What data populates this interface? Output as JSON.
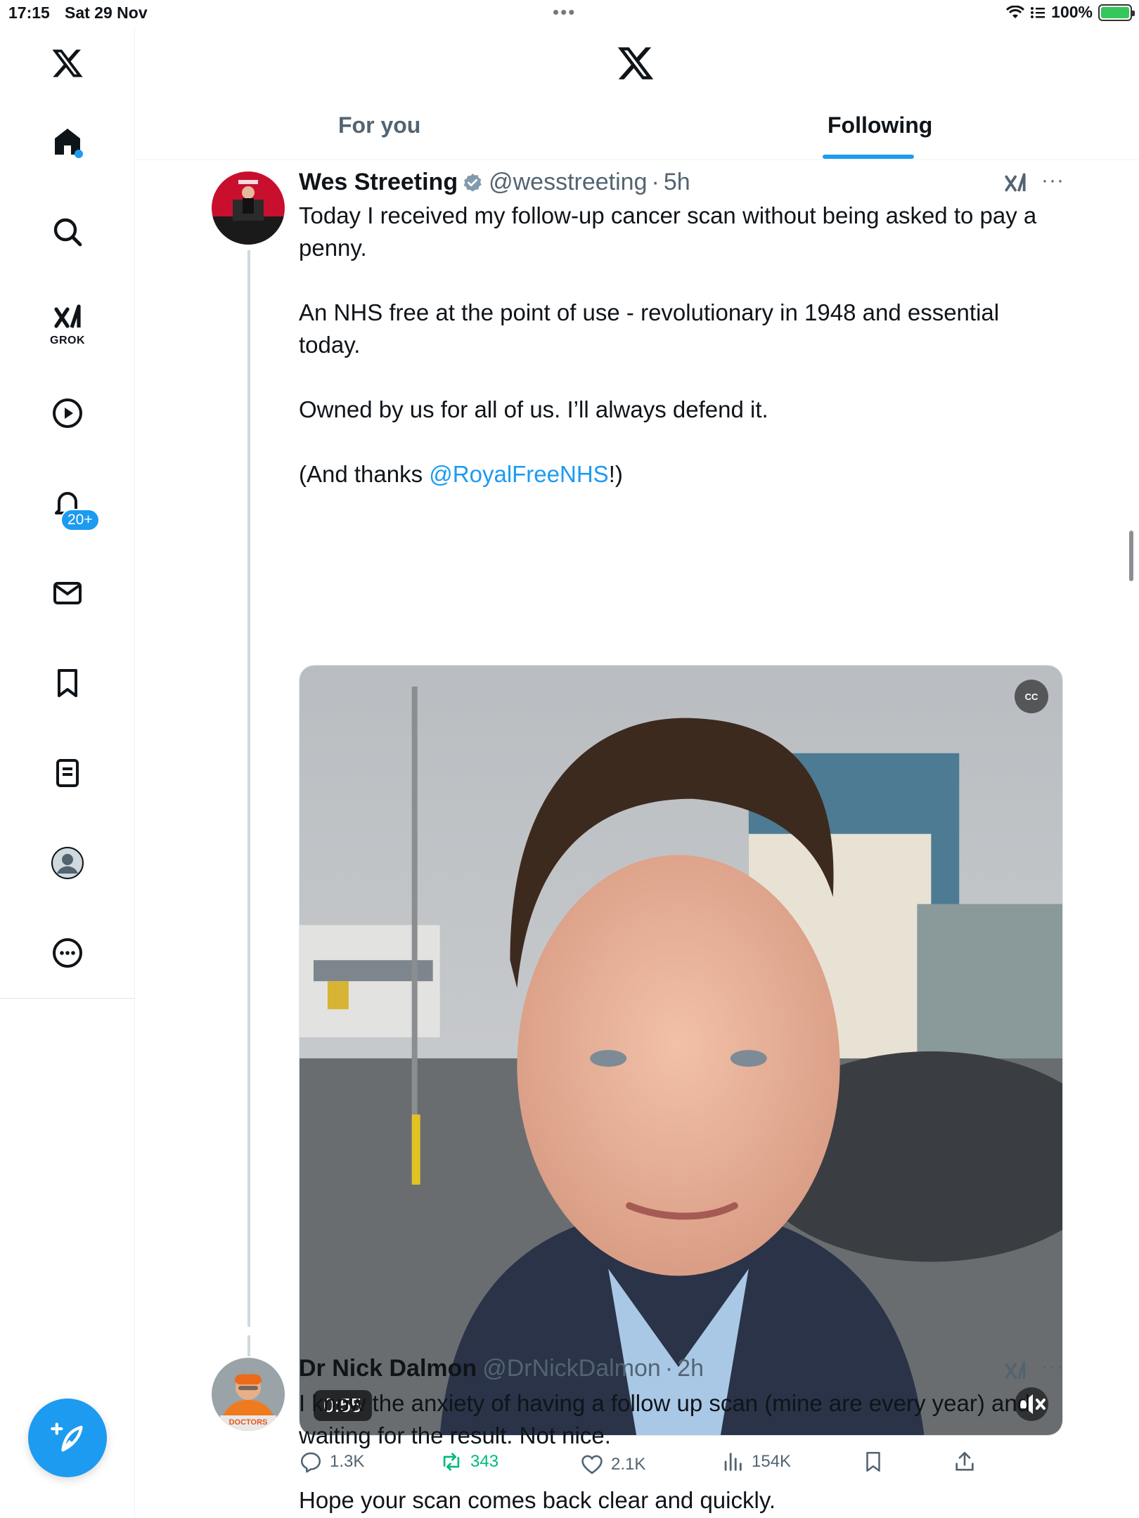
{
  "status_bar": {
    "time": "17:15",
    "date": "Sat 29 Nov",
    "battery": "100%",
    "accent_charging": "#34c759"
  },
  "sidebar": {
    "items": [
      {
        "name": "x-logo-icon"
      },
      {
        "name": "home-icon"
      },
      {
        "name": "search-icon"
      },
      {
        "name": "grok-icon",
        "label": "GROK"
      },
      {
        "name": "video-icon"
      },
      {
        "name": "notifications-icon",
        "badge": "20+"
      },
      {
        "name": "messages-icon"
      },
      {
        "name": "bookmarks-icon"
      },
      {
        "name": "lists-icon"
      },
      {
        "name": "profile-icon"
      },
      {
        "name": "more-icon"
      }
    ],
    "compose_icon": "compose-post-icon"
  },
  "header": {
    "tabs": [
      {
        "label": "For you",
        "active": false
      },
      {
        "label": "Following",
        "active": true
      }
    ],
    "accent": "#1d9bf0"
  },
  "tweets": [
    {
      "display_name": "Wes Streeting",
      "verified": true,
      "handle": "@wesstreeting",
      "separator": "·",
      "time": "5h",
      "paragraphs": [
        "Today I received my follow-up cancer scan without being asked to pay a penny.",
        "An NHS free at the point of use - revolutionary in 1948 and essential today.",
        "Owned by us for all of us. I’ll always defend it."
      ],
      "last_para_prefix": "(And thanks ",
      "mention": "@RoyalFreeNHS",
      "last_para_suffix": "!)",
      "media": {
        "type": "video",
        "duration": "0:55",
        "cc_label": "CC"
      },
      "stats": {
        "replies": "1.3K",
        "reposts": "343",
        "likes": "2.1K",
        "views": "154K"
      }
    },
    {
      "display_name": "Dr Nick Dalmon",
      "handle": "@DrNickDalmon",
      "separator": "·",
      "time": "2h",
      "paragraphs": [
        "I know the anxiety of having a follow up scan (mine are every year) and waiting for the result. Not nice.",
        "Hope your scan comes back clear and quickly."
      ],
      "avatar_sign": "DOCTORS"
    }
  ]
}
